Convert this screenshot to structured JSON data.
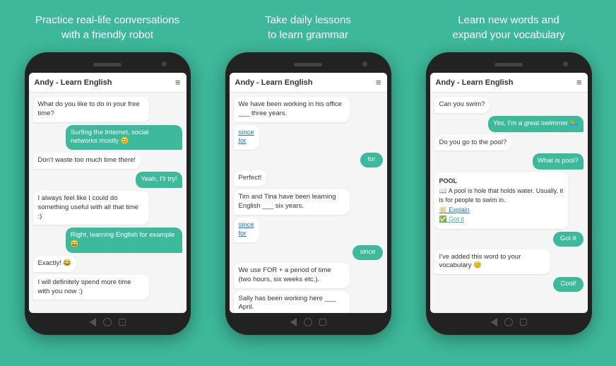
{
  "captions": [
    {
      "line1": "Practice real-life conversations",
      "line2": "with a friendly robot"
    },
    {
      "line1": "Take daily lessons",
      "line2": "to learn grammar"
    },
    {
      "line1": "Learn new words and",
      "line2": "expand your vocabulary"
    }
  ],
  "phones": [
    {
      "header": "Andy - Learn English",
      "messages": [
        {
          "side": "left",
          "text": "What do you like to do in your free time?"
        },
        {
          "side": "right",
          "text": "Surfing the Internet, social networks mostly 😊"
        },
        {
          "side": "left",
          "text": "Don't waste too much time there!"
        },
        {
          "side": "right",
          "text": "Yeah, I'll try!"
        },
        {
          "side": "left",
          "text": "I always feel like I could do something useful with all that time :)"
        },
        {
          "side": "right",
          "text": "Right, learning English for example 😄"
        },
        {
          "side": "left",
          "text": "Exactly! 😂"
        },
        {
          "side": "left",
          "text": "I will definitely spend more time with you now :)"
        }
      ]
    },
    {
      "header": "Andy - Learn English",
      "messages": [
        {
          "side": "left",
          "text": "We have been working in his office ___ three years."
        },
        {
          "side": "left-link",
          "text": "since\nfor"
        },
        {
          "side": "right-float",
          "text": "for"
        },
        {
          "side": "left",
          "text": "Perfect!"
        },
        {
          "side": "left",
          "text": "Tim and Tina have been learning English ___ six years."
        },
        {
          "side": "left-link",
          "text": "since\nfor"
        },
        {
          "side": "right-float",
          "text": "since"
        },
        {
          "side": "left",
          "text": "We use FOR + a period of time (two hours, six weeks etc.)."
        },
        {
          "side": "left",
          "text": "Sally has been working here ___ April."
        }
      ]
    },
    {
      "header": "Andy - Learn English",
      "messages": [
        {
          "side": "left",
          "text": "Can you swim?"
        },
        {
          "side": "right",
          "text": "Yes, I'm a great swimmer 🏊"
        },
        {
          "side": "left",
          "text": "Do you go to the pool?"
        },
        {
          "side": "right",
          "text": "What is pool?"
        },
        {
          "side": "vocab",
          "text": "POOL\n📖 A pool is hole that holds water. Usually, it is for people to swim in.\n🔆 Explain\n✅ Got it"
        },
        {
          "side": "right-float",
          "text": "Got it"
        },
        {
          "side": "left",
          "text": "I've added this word to your vocabulary 😊"
        },
        {
          "side": "right-float",
          "text": "Cool!"
        }
      ]
    }
  ]
}
